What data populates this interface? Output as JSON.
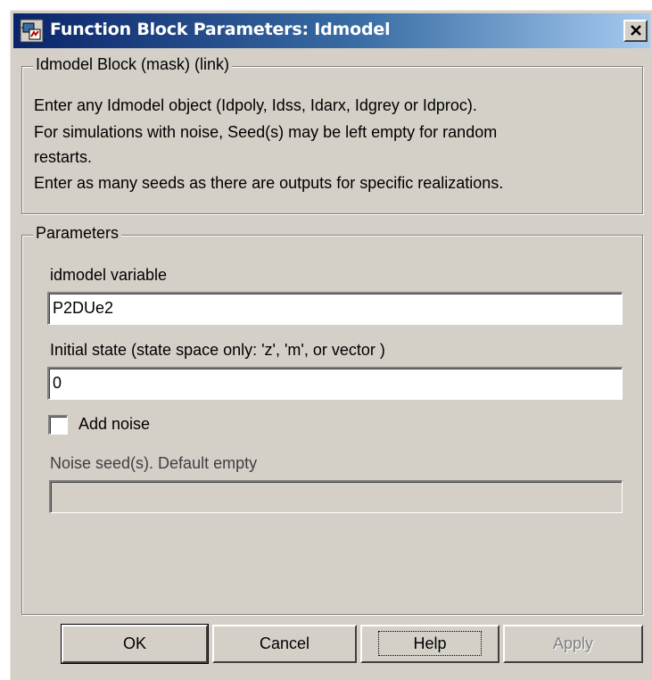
{
  "window": {
    "title": "Function Block Parameters: Idmodel"
  },
  "description_group": {
    "legend": "Idmodel Block (mask) (link)",
    "lines": [
      "Enter any Idmodel object (Idpoly, Idss, Idarx, Idgrey or Idproc).",
      "For simulations  with noise, Seed(s) may be left empty for random",
      "restarts.",
      "Enter as many seeds as there are outputs for specific realizations."
    ]
  },
  "parameters_group": {
    "legend": "Parameters",
    "idmodel_variable": {
      "label": "idmodel variable",
      "value": "P2DUe2"
    },
    "initial_state": {
      "label": "Initial state (state space only: 'z', 'm', or vector )",
      "value": "0"
    },
    "add_noise": {
      "label": "Add noise",
      "checked": false
    },
    "noise_seeds": {
      "label": "Noise seed(s).  Default empty",
      "value": "",
      "enabled": false
    }
  },
  "buttons": {
    "ok": "OK",
    "cancel": "Cancel",
    "help": "Help",
    "apply": "Apply"
  },
  "colors": {
    "face": "#d4d0c8",
    "title_start": "#0a246a",
    "title_end": "#a6caf0"
  }
}
